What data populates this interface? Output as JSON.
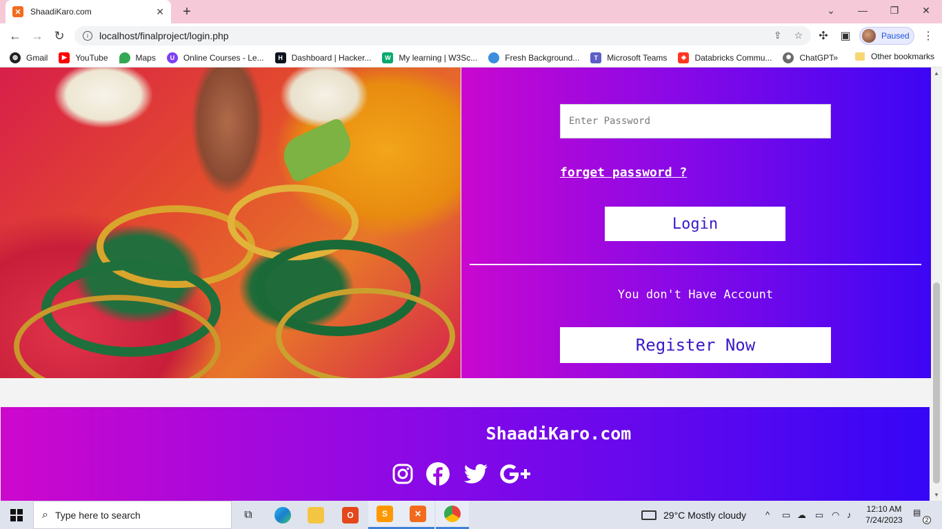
{
  "browser": {
    "tab_title": "ShaadiKaro.com",
    "tab_close": "✕",
    "new_tab": "+",
    "url": "localhost/finalproject/login.php",
    "profile_status": "Paused",
    "bookmarks": [
      {
        "label": "Gmail",
        "icon": "globe-icon",
        "color": "#202124"
      },
      {
        "label": "YouTube",
        "icon": "youtube-icon",
        "color": "#ff0000"
      },
      {
        "label": "Maps",
        "icon": "maps-pin-icon",
        "color": "#34a853"
      },
      {
        "label": "Online Courses - Le...",
        "icon": "courses-icon",
        "color": "#7e3ff2"
      },
      {
        "label": "Dashboard | Hacker...",
        "icon": "hackerrank-icon",
        "color": "#0e141e"
      },
      {
        "label": "My learning | W3Sc...",
        "icon": "w3schools-icon",
        "color": "#04aa6d"
      },
      {
        "label": "Fresh Background...",
        "icon": "blob-icon",
        "color": "#3c8dde"
      },
      {
        "label": "Microsoft Teams",
        "icon": "teams-icon",
        "color": "#5b5fc7"
      },
      {
        "label": "Databricks Commu...",
        "icon": "databricks-icon",
        "color": "#ff3621"
      },
      {
        "label": "ChatGPT",
        "icon": "chatgpt-icon",
        "color": "#6b6b6b"
      }
    ],
    "bookmarks_more": "»",
    "other_bookmarks": "Other bookmarks"
  },
  "login": {
    "password_placeholder": "Enter Password",
    "forget_password": "forget password ?",
    "login_button": "Login",
    "no_account_text": "You don't Have Account",
    "register_button": "Register Now"
  },
  "footer": {
    "brand": "ShaadiKaro.com",
    "social": [
      "instagram-icon",
      "facebook-icon",
      "twitter-icon",
      "google-plus-icon"
    ]
  },
  "taskbar": {
    "search_placeholder": "Type here to search",
    "weather": "29°C  Mostly cloudy",
    "time": "12:10 AM",
    "date": "7/24/2023",
    "notification_count": "2"
  },
  "colors": {
    "panel_gradient_start": "#c908d0",
    "panel_gradient_end": "#3c06f4",
    "button_text": "#3b18c9"
  }
}
